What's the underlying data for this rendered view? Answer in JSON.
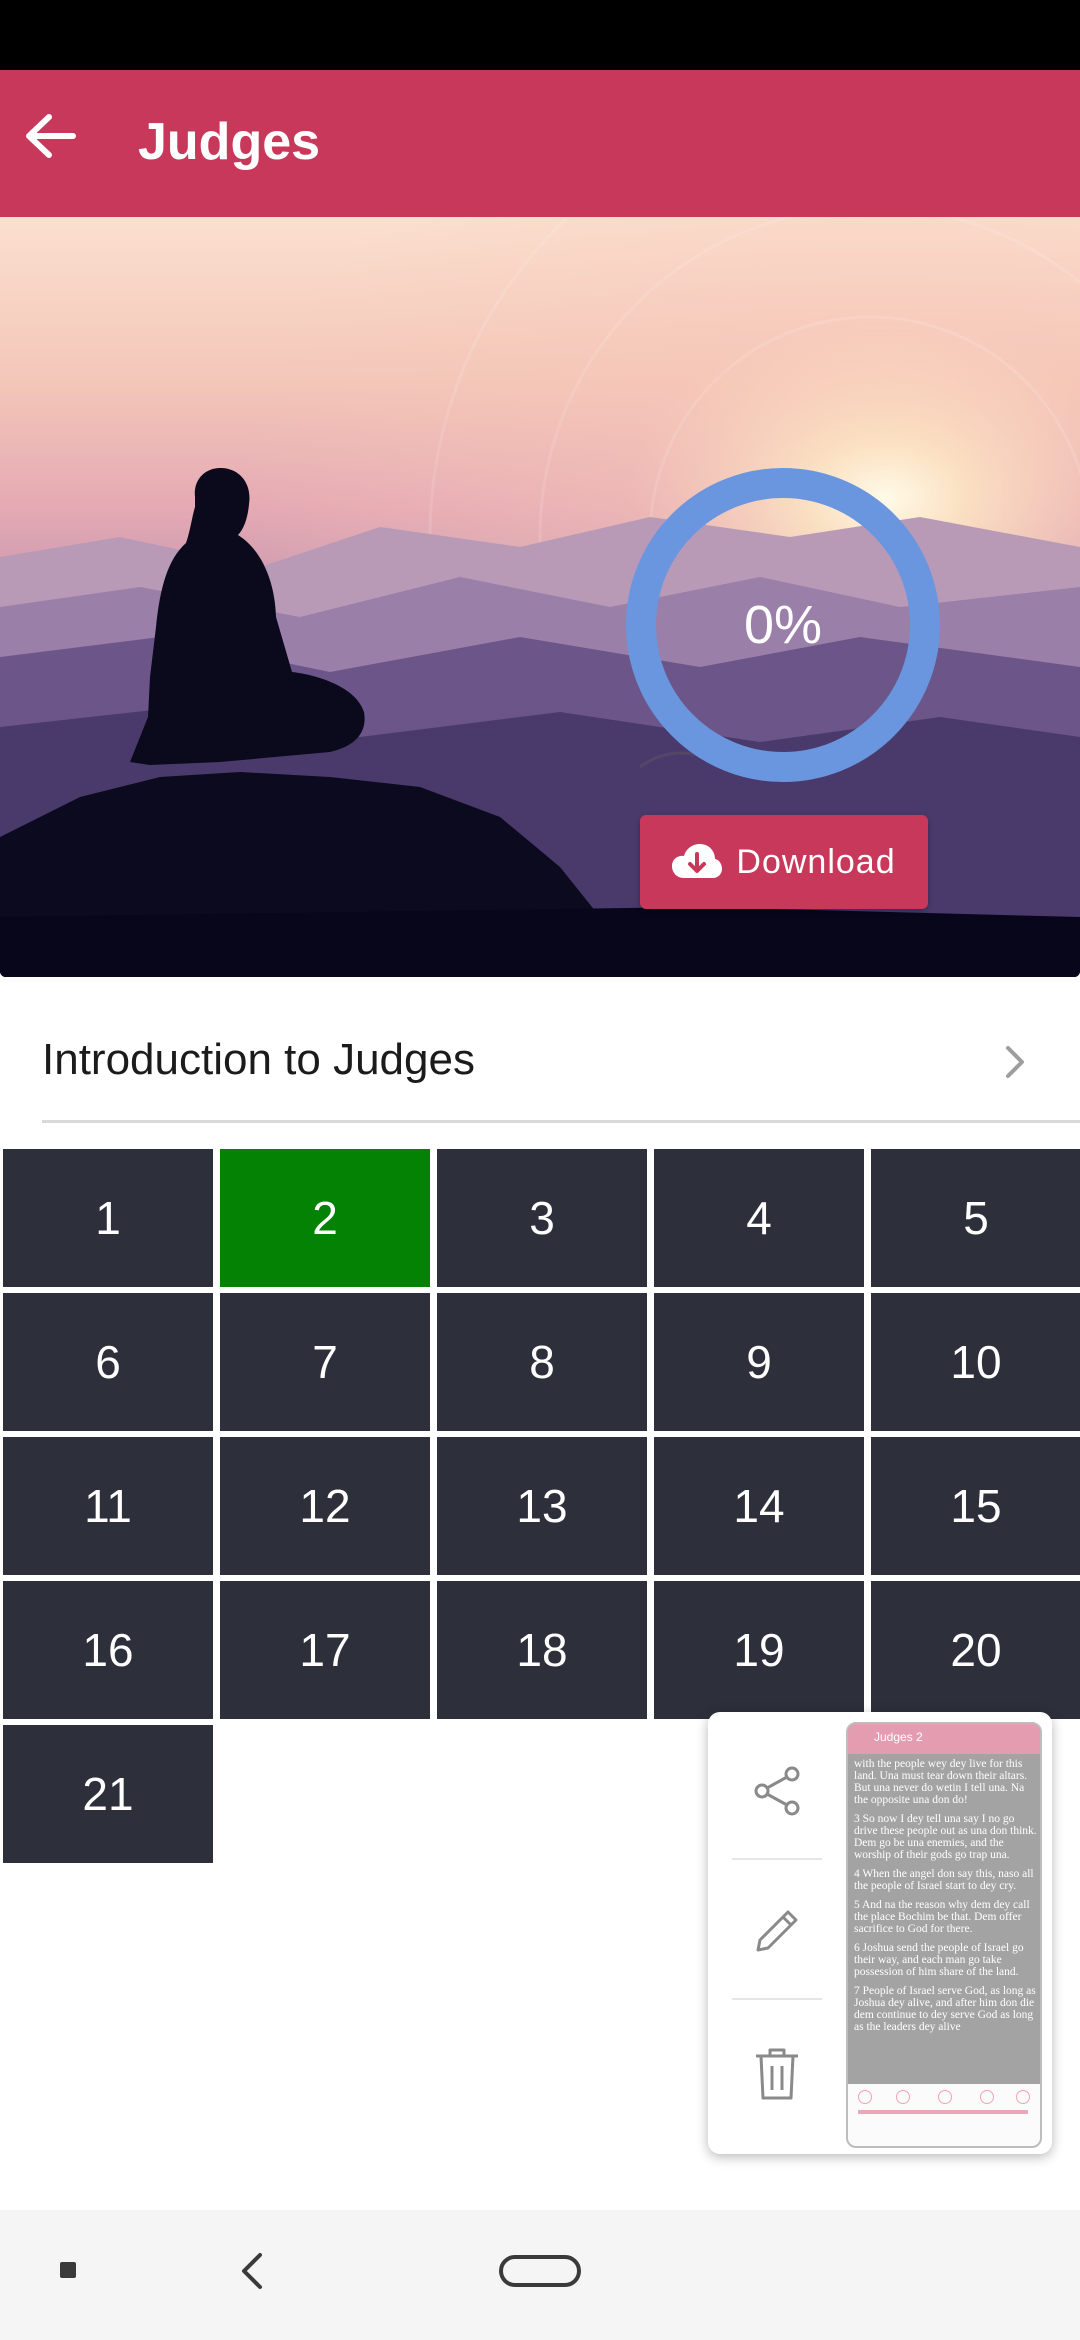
{
  "app_bar": {
    "title": "Judges",
    "back_icon": "arrow-left-icon",
    "background": "#c8385a"
  },
  "hero": {
    "image": "silhouette-meditating-sunset",
    "progress": {
      "label": "0%",
      "value": 0,
      "ring_color": "#6a96df"
    },
    "download_button": {
      "label": "Download",
      "icon": "cloud-download-icon"
    }
  },
  "intro": {
    "label": "Introduction to Judges",
    "chevron_icon": "chevron-right-icon"
  },
  "chapters": {
    "selected": "2",
    "items": [
      "1",
      "2",
      "3",
      "4",
      "5",
      "6",
      "7",
      "8",
      "9",
      "10",
      "11",
      "12",
      "13",
      "14",
      "15",
      "16",
      "17",
      "18",
      "19",
      "20",
      "21"
    ]
  },
  "screenshot_panel": {
    "actions": [
      "share-icon",
      "edit-icon",
      "delete-icon"
    ],
    "preview": {
      "title": "Judges 2",
      "paragraphs": [
        "with the people wey dey live for this land. Una must tear down their altars. But una never do wetin I tell una. Na the opposite una don do!",
        "3 So now I dey tell una say I no go drive these people out as una don think. Dem go be una enemies, and the worship of their gods go trap una.",
        "4 When the angel don say this, naso all the people of Israel start to dey cry.",
        "5 And na the reason why dem dey call the place Bochim be that. Dem offer sacrifice to God for there.",
        "6 Joshua send the people of Israel go their way, and each man go take possession of him share of the land.",
        "7 People of Israel serve God, as long as Joshua dey alive, and after him don die dem continue to dey serve God as long as the leaders dey alive"
      ]
    }
  },
  "nav_bar": {
    "items": [
      "recents-icon",
      "back-icon",
      "home-icon"
    ]
  }
}
